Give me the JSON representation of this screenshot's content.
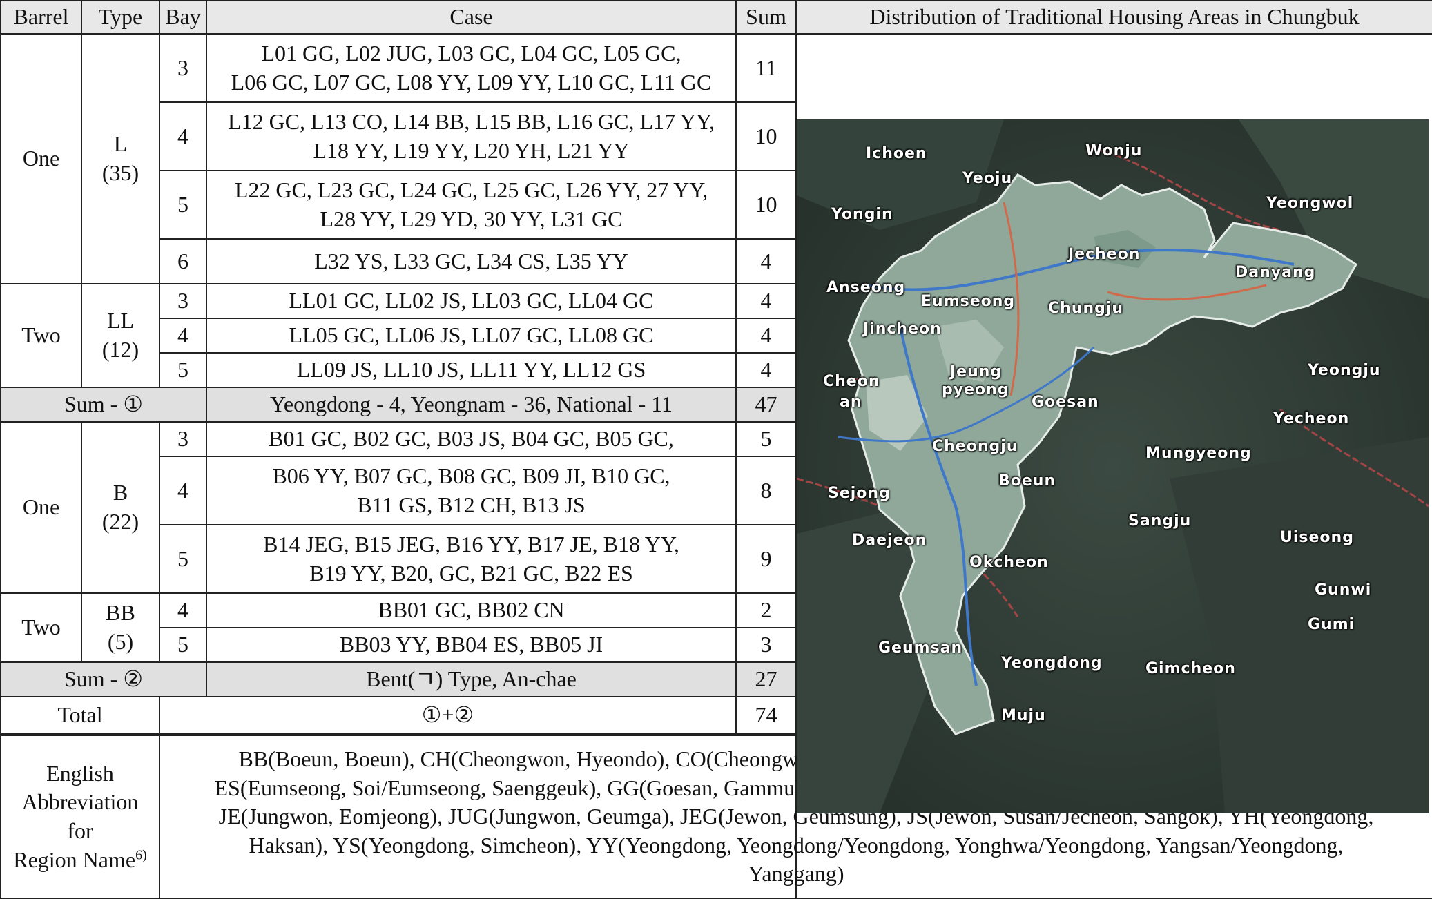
{
  "headers": {
    "barrel": "Barrel",
    "type": "Type",
    "bay": "Bay",
    "case": "Case",
    "sum": "Sum",
    "map_title": "Distribution of Traditional Housing Areas in Chungbuk"
  },
  "groupA": {
    "barrel_one": "One",
    "type_L": "L",
    "type_L_count": "(35)",
    "rows_L": [
      {
        "bay": "3",
        "lines": [
          "L01 GG, L02 JUG, L03 GC, L04 GC, L05 GC,",
          "L06 GC, L07 GC, L08 YY, L09 YY, L10 GC, L11 GC"
        ],
        "sum": "11"
      },
      {
        "bay": "4",
        "lines": [
          "L12 GC, L13 CO, L14 BB, L15 BB, L16 GC, L17 YY,",
          "L18 YY, L19 YY, L20 YH, L21 YY"
        ],
        "sum": "10"
      },
      {
        "bay": "5",
        "lines": [
          "L22 GC, L23 GC, L24 GC, L25 GC, L26 YY, 27 YY,",
          "L28 YY, L29 YD, 30 YY, L31 GC"
        ],
        "sum": "10"
      },
      {
        "bay": "6",
        "lines": [
          "L32 YS, L33 GC, L34 CS, L35 YY"
        ],
        "sum": "4"
      }
    ],
    "barrel_two": "Two",
    "type_LL": "LL",
    "type_LL_count": "(12)",
    "rows_LL": [
      {
        "bay": "3",
        "lines": [
          "LL01 GC, LL02 JS, LL03 GC, LL04 GC"
        ],
        "sum": "4"
      },
      {
        "bay": "4",
        "lines": [
          "LL05 GC, LL06 JS, LL07 GC, LL08 GC"
        ],
        "sum": "4"
      },
      {
        "bay": "5",
        "lines": [
          "LL09 JS, LL10 JS, LL11 YY, LL12 GS"
        ],
        "sum": "4"
      }
    ],
    "sum_label": "Sum - ①",
    "sum_case": "Yeongdong - 4, Yeongnam - 36, National - 11",
    "sum_value": "47"
  },
  "groupB": {
    "barrel_one": "One",
    "type_B": "B",
    "type_B_count": "(22)",
    "rows_B": [
      {
        "bay": "3",
        "lines": [
          "B01 GC, B02 GC, B03 JS, B04 GC, B05 GC,"
        ],
        "sum": "5"
      },
      {
        "bay": "4",
        "lines": [
          "B06 YY, B07 GC, B08 GC, B09 JI, B10 GC,",
          "B11 GS, B12 CH, B13 JS"
        ],
        "sum": "8"
      },
      {
        "bay": "5",
        "lines": [
          "B14 JEG, B15 JEG, B16 YY, B17 JE, B18 YY,",
          "B19 YY, B20, GC, B21 GC, B22 ES"
        ],
        "sum": "9"
      }
    ],
    "barrel_two": "Two",
    "type_BB": "BB",
    "type_BB_count": "(5)",
    "rows_BB": [
      {
        "bay": "4",
        "lines": [
          "BB01 GC, BB02 CN"
        ],
        "sum": "2"
      },
      {
        "bay": "5",
        "lines": [
          "BB03 YY, BB04 ES, BB05 JI"
        ],
        "sum": "3"
      }
    ],
    "sum_label": "Sum - ②",
    "sum_case": "Bent(ㄱ) Type, An-chae",
    "sum_value": "27"
  },
  "total": {
    "label": "Total",
    "formula": "①+②",
    "value": "74"
  },
  "abbreviation": {
    "label_lines": [
      "English",
      "Abbreviation",
      "for",
      "Region Name"
    ],
    "footnote": "6)",
    "lines": [
      "BB(Boeun, Boeun), CH(Cheongwon, Hyeondo), CO(Cheongwon, Oksam), CN(Cheongwon, Namil), CS(Cheongju, Sinjeon),",
      "ES(Eumseong, Soi/Eumseong, Saenggeuk), GG(Goesan, Gammul), GC(Goesan,Cheongan), GS(Goesan, Sosu), JI(Jincheon, Iwol),",
      "JE(Jungwon, Eomjeong), JUG(Jungwon, Geumga), JEG(Jewon, Geumsung), JS(Jewon, Susan/Jecheon, Sangok), YH(Yeongdong,",
      "Haksan), YS(Yeongdong, Simcheon), YY(Yeongdong, Yeongdong/Yeongdong, Yonghwa/Yeongdong, Yangsan/Yeongdong,",
      "Yanggang)"
    ]
  },
  "map": {
    "colors": {
      "background": "#2e3a33",
      "region": "#8fa89a",
      "roads": "#3f78c8",
      "borders": "#b04040"
    },
    "labels": [
      "Ichoen",
      "Wonju",
      "Yeoju",
      "Yongin",
      "Yeongwol",
      "Jecheon",
      "Danyang",
      "Anseong",
      "Eumseong",
      "Chungju",
      "Jincheon",
      "Cheon",
      "an",
      "Jeung",
      "pyeong",
      "Goesan",
      "Yeongju",
      "Yecheon",
      "Cheongju",
      "Mungyeong",
      "Boeun",
      "Sejong",
      "Sangju",
      "Uiseong",
      "Daejeon",
      "Okcheon",
      "Gunwi",
      "Gumi",
      "Geumsan",
      "Yeongdong",
      "Gimcheon",
      "Muju"
    ]
  }
}
